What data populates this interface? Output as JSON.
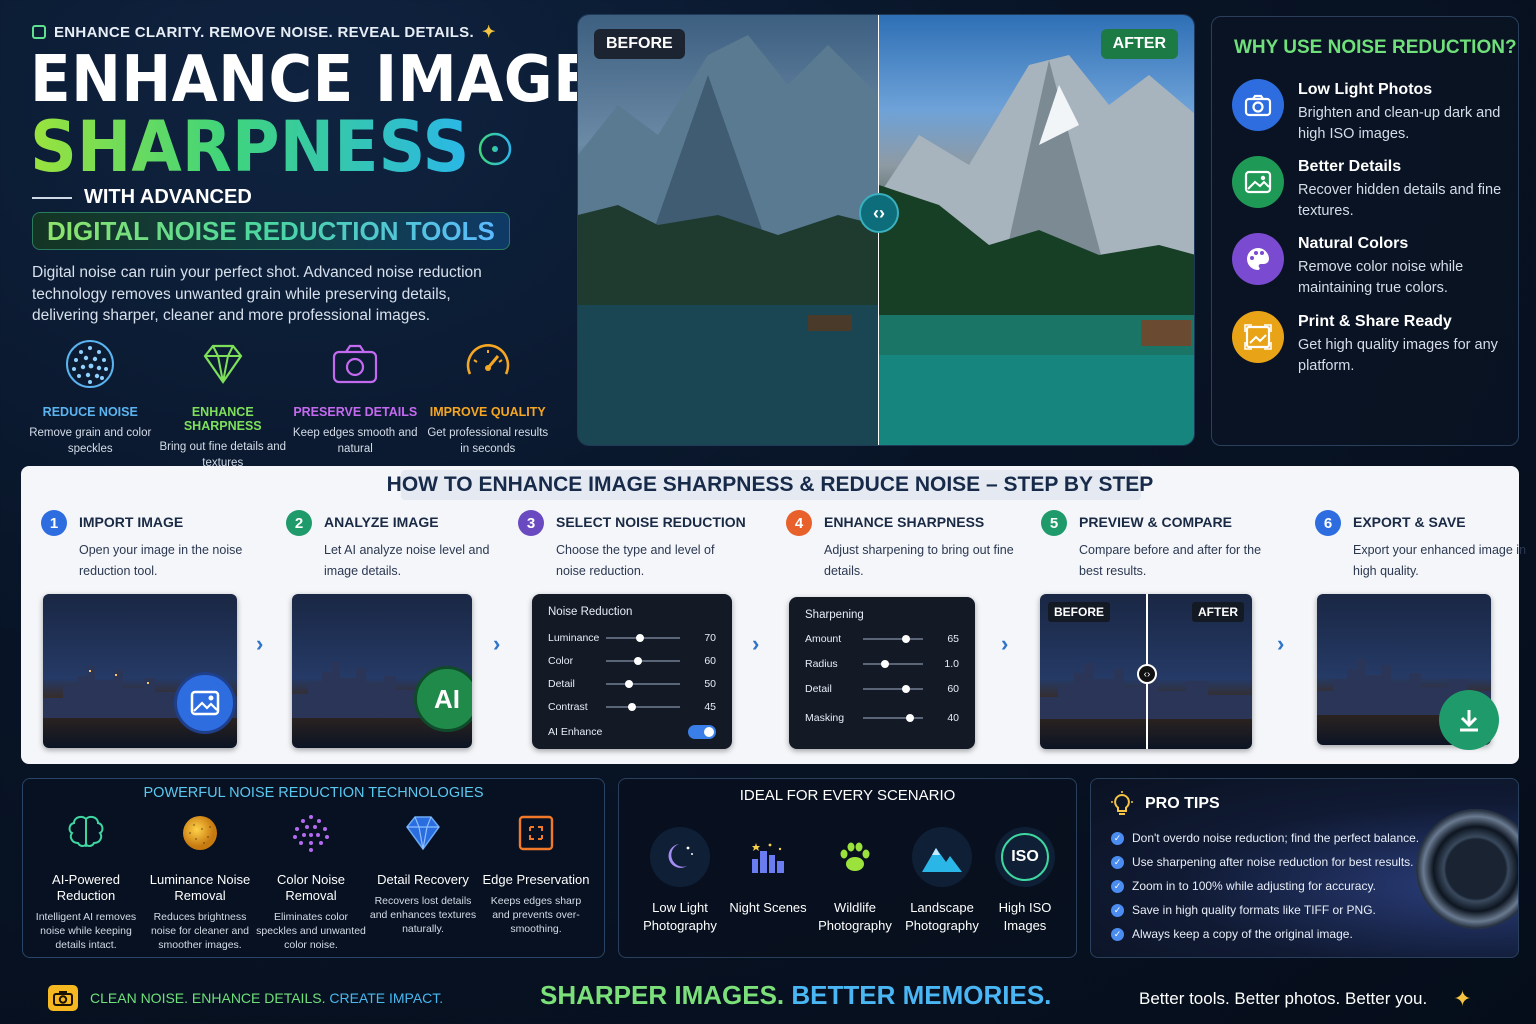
{
  "hero": {
    "tagline": "ENHANCE CLARITY. REMOVE NOISE. REVEAL DETAILS.",
    "title_line1": "ENHANCE IMAGE",
    "title_line2": "SHARPNESS",
    "subtitle": "WITH ADVANCED",
    "pill": "DIGITAL NOISE REDUCTION TOOLS",
    "intro": "Digital noise can ruin your perfect shot. Advanced noise reduction technology removes unwanted grain while preserving details, delivering sharper, cleaner and more professional images.",
    "features": [
      {
        "title": "REDUCE NOISE",
        "desc": "Remove grain and color speckles",
        "color": "#5bb4f0",
        "icon": "noise-dots-icon"
      },
      {
        "title": "ENHANCE SHARPNESS",
        "desc": "Bring out fine details and textures",
        "color": "#7ee05a",
        "icon": "diamond-icon"
      },
      {
        "title": "PRESERVE DETAILS",
        "desc": "Keep edges smooth and natural",
        "color": "#c46af0",
        "icon": "camera-icon"
      },
      {
        "title": "IMPROVE QUALITY",
        "desc": "Get professional results in seconds",
        "color": "#f5a623",
        "icon": "gauge-icon"
      }
    ]
  },
  "comparison": {
    "before_label": "BEFORE",
    "after_label": "AFTER"
  },
  "why": {
    "title": "WHY USE NOISE REDUCTION?",
    "items": [
      {
        "title": "Low Light Photos",
        "desc": "Brighten and clean-up dark and high ISO images.",
        "color": "#2d6de0",
        "icon": "camera-icon"
      },
      {
        "title": "Better Details",
        "desc": "Recover hidden details and fine textures.",
        "color": "#1f9a56",
        "icon": "image-icon"
      },
      {
        "title": "Natural Colors",
        "desc": "Remove color noise while maintaining true colors.",
        "color": "#7a4ad0",
        "icon": "palette-icon"
      },
      {
        "title": "Print & Share Ready",
        "desc": "Get high quality images for any platform.",
        "color": "#e8a317",
        "icon": "expand-image-icon"
      }
    ]
  },
  "steps": {
    "title": "HOW TO ENHANCE IMAGE SHARPNESS & REDUCE NOISE – STEP BY STEP",
    "items": [
      {
        "num": "1",
        "title": "IMPORT IMAGE",
        "desc": "Open your image in the noise reduction tool.",
        "color": "#2d6de0"
      },
      {
        "num": "2",
        "title": "ANALYZE IMAGE",
        "desc": "Let AI analyze noise level and image details.",
        "color": "#1f9a6a"
      },
      {
        "num": "3",
        "title": "SELECT NOISE REDUCTION",
        "desc": "Choose the type and level of noise reduction.",
        "color": "#6a4ac0"
      },
      {
        "num": "4",
        "title": "ENHANCE SHARPNESS",
        "desc": "Adjust sharpening to bring out fine details.",
        "color": "#e8602a"
      },
      {
        "num": "5",
        "title": "PREVIEW & COMPARE",
        "desc": "Compare before and after for the best results.",
        "color": "#1f9a6a"
      },
      {
        "num": "6",
        "title": "EXPORT & SAVE",
        "desc": "Export your enhanced image in high quality.",
        "color": "#2d6de0"
      }
    ],
    "ai_badge": "AI",
    "noise_panel": {
      "title": "Noise Reduction",
      "sliders": [
        {
          "label": "Luminance",
          "value": 70
        },
        {
          "label": "Color",
          "value": 60
        },
        {
          "label": "Detail",
          "value": 50
        },
        {
          "label": "Contrast",
          "value": 45
        }
      ],
      "toggle_label": "AI Enhance"
    },
    "sharpen_panel": {
      "title": "Sharpening",
      "sliders": [
        {
          "label": "Amount",
          "value": "65",
          "frac": 0.65
        },
        {
          "label": "Radius",
          "value": "1.0",
          "frac": 0.3
        },
        {
          "label": "Detail",
          "value": "60",
          "frac": 0.65
        },
        {
          "label": "Masking",
          "value": "40",
          "frac": 0.72
        }
      ]
    },
    "preview_before": "BEFORE",
    "preview_after": "AFTER"
  },
  "tech": {
    "title": "POWERFUL NOISE REDUCTION TECHNOLOGIES",
    "items": [
      {
        "title": "AI-Powered Reduction",
        "desc": "Intelligent AI removes noise while keeping details intact.",
        "color": "#3fd6a0",
        "icon": "brain-icon"
      },
      {
        "title": "Luminance Noise Removal",
        "desc": "Reduces brightness noise for cleaner and smoother images.",
        "color": "#f5a623",
        "icon": "grain-sphere-icon"
      },
      {
        "title": "Color Noise Removal",
        "desc": "Eliminates color speckles and unwanted color noise.",
        "color": "#b46af0",
        "icon": "color-dots-icon"
      },
      {
        "title": "Detail Recovery",
        "desc": "Recovers lost details and enhances textures naturally.",
        "color": "#3a8cf0",
        "icon": "diamond-icon"
      },
      {
        "title": "Edge Preservation",
        "desc": "Keeps edges sharp and prevents over-smoothing.",
        "color": "#f07a2a",
        "icon": "edge-frame-icon"
      }
    ]
  },
  "ideal": {
    "title": "IDEAL FOR EVERY SCENARIO",
    "items": [
      {
        "label": "Low Light Photography",
        "icon": "moon-icon"
      },
      {
        "label": "Night Scenes",
        "icon": "city-night-icon"
      },
      {
        "label": "Wildlife Photography",
        "icon": "paw-icon"
      },
      {
        "label": "Landscape Photography",
        "icon": "mountain-icon"
      },
      {
        "label": "High ISO Images",
        "icon": "iso-icon"
      }
    ],
    "iso_text": "ISO"
  },
  "tips": {
    "title": "PRO TIPS",
    "items": [
      "Don't overdo noise reduction; find the perfect balance.",
      "Use sharpening after noise reduction for best results.",
      "Zoom in to 100% while adjusting for accuracy.",
      "Save in high quality formats like TIFF or PNG.",
      "Always keep a copy of the original image."
    ]
  },
  "footer": {
    "left_a": "CLEAN NOISE. ENHANCE DETAILS.",
    "left_b": "CREATE IMPACT.",
    "mid_a": "SHARPER IMAGES.",
    "mid_b": "BETTER MEMORIES.",
    "right": "Better tools. Better photos. Better you."
  }
}
